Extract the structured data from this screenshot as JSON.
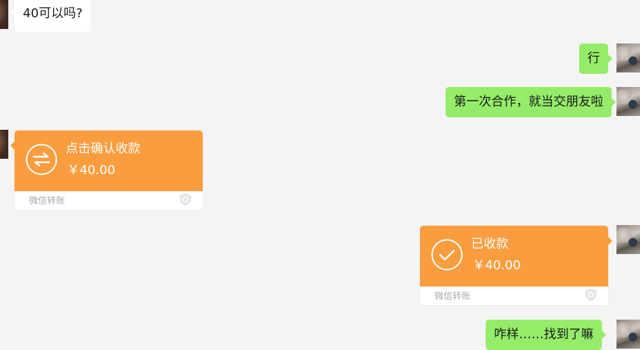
{
  "messages": {
    "m1": {
      "text": "40可以吗?"
    },
    "m2": {
      "text": "行"
    },
    "m3": {
      "text": "第一次合作，就当交朋友啦"
    },
    "m6": {
      "text": "咋样……找到了嘛"
    }
  },
  "transfer_received": {
    "title": "点击确认收款",
    "amount": "￥40.00",
    "footer": "微信转账",
    "icon": "transfer-arrows-icon"
  },
  "transfer_confirmed": {
    "title": "已收款",
    "amount": "￥40.00",
    "footer": "微信转账",
    "icon": "check-circle-icon"
  },
  "colors": {
    "background": "#f4f4f4",
    "incoming_bubble": "#ffffff",
    "outgoing_bubble": "#95ec69",
    "transfer_card": "#f99d3f"
  }
}
